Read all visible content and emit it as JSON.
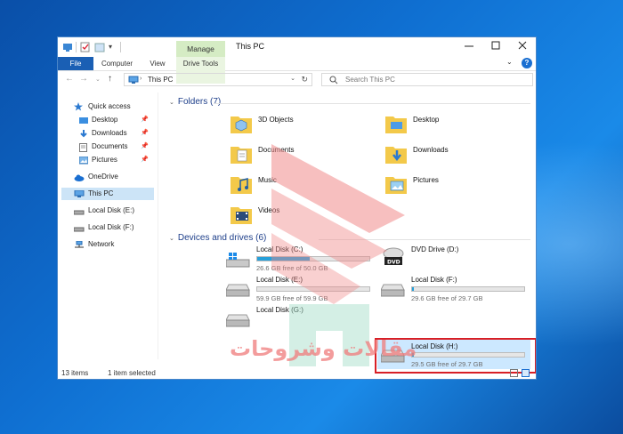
{
  "window": {
    "title": "This PC",
    "context_tab": "Manage"
  },
  "ribbon": {
    "tabs": [
      {
        "label": "File"
      },
      {
        "label": "Computer"
      },
      {
        "label": "View"
      },
      {
        "label": "Drive Tools"
      }
    ]
  },
  "address": {
    "path": "This PC",
    "search_placeholder": "Search This PC"
  },
  "sidebar": {
    "items": [
      {
        "label": "Quick access"
      },
      {
        "label": "Desktop"
      },
      {
        "label": "Downloads"
      },
      {
        "label": "Documents"
      },
      {
        "label": "Pictures"
      },
      {
        "label": "OneDrive"
      },
      {
        "label": "This PC"
      },
      {
        "label": "Local Disk (E:)"
      },
      {
        "label": "Local Disk (F:)"
      },
      {
        "label": "Network"
      }
    ]
  },
  "folders": {
    "heading": "Folders (7)",
    "items": [
      {
        "label": "3D Objects"
      },
      {
        "label": "Desktop"
      },
      {
        "label": "Documents"
      },
      {
        "label": "Downloads"
      },
      {
        "label": "Music"
      },
      {
        "label": "Pictures"
      },
      {
        "label": "Videos"
      }
    ]
  },
  "drives": {
    "heading": "Devices and drives (6)",
    "items": [
      {
        "name": "Local Disk (C:)",
        "free": "26.6 GB free of 50.0 GB",
        "used_fraction": 0.47
      },
      {
        "name": "DVD Drive (D:)",
        "free": "",
        "used_fraction": null
      },
      {
        "name": "Local Disk (E:)",
        "free": "59.9 GB free of 59.9 GB",
        "used_fraction": 0.0
      },
      {
        "name": "Local Disk (F:)",
        "free": "29.6 GB free of 29.7 GB",
        "used_fraction": 0.003
      },
      {
        "name": "Local Disk (G:)",
        "free": "",
        "used_fraction": null
      },
      {
        "name": "Local Disk (H:)",
        "free": "29.5 GB free of 29.7 GB",
        "used_fraction": 0.007
      }
    ]
  },
  "status": {
    "items_count": "13 items",
    "selection": "1 item selected"
  },
  "watermark": {
    "text": "مقالات وشروحات"
  },
  "colors": {
    "accent": "#1a5fb4",
    "selection": "#cce8ff",
    "highlight_box": "#d81f26",
    "bar_fill": "#26a0da",
    "manage_tab": "#d5ecc4"
  }
}
